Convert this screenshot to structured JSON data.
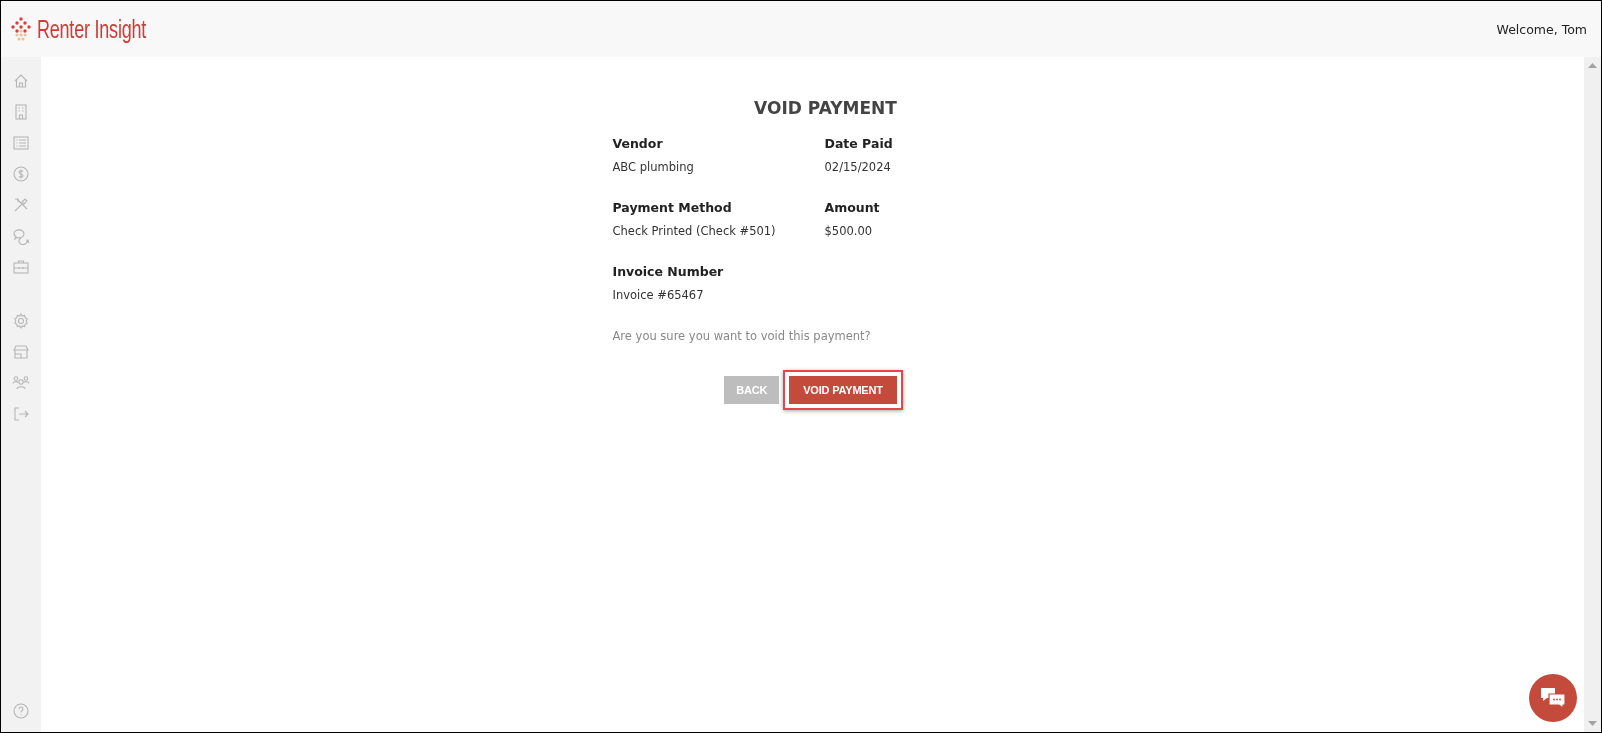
{
  "header": {
    "logo": "Renter Insight",
    "welcome": "Welcome, Tom"
  },
  "form": {
    "title": "VOID PAYMENT",
    "fields": [
      {
        "label": "Vendor",
        "value": "ABC plumbing"
      },
      {
        "label": "Date Paid",
        "value": "02/15/2024"
      },
      {
        "label": "Payment Method",
        "value": "Check Printed (Check #501)"
      },
      {
        "label": "Amount",
        "value": "$500.00"
      },
      {
        "label": "Invoice Number",
        "value": "Invoice #65467"
      }
    ],
    "prompt": "Are you sure you want to void this payment?",
    "buttons": [
      {
        "label": "BACK",
        "kind": "secondary",
        "highlighted": false
      },
      {
        "label": "VOID PAYMENT",
        "kind": "primary",
        "highlighted": true
      }
    ]
  }
}
